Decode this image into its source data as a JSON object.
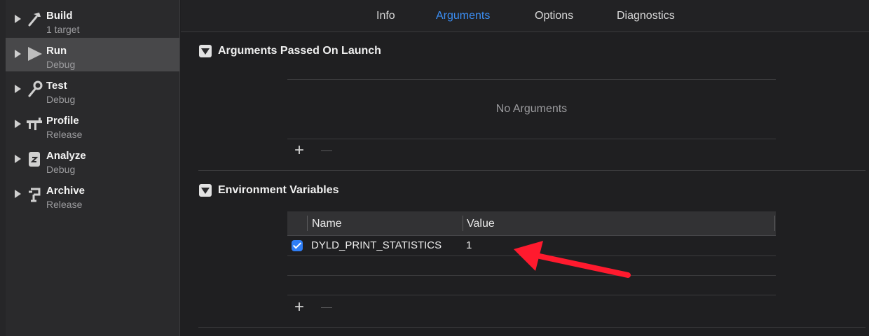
{
  "sidebar": {
    "items": [
      {
        "title": "Build",
        "subtitle": "1 target",
        "icon": "hammer-icon",
        "selected": false
      },
      {
        "title": "Run",
        "subtitle": "Debug",
        "icon": "play-icon",
        "selected": true
      },
      {
        "title": "Test",
        "subtitle": "Debug",
        "icon": "wrench-icon",
        "selected": false
      },
      {
        "title": "Profile",
        "subtitle": "Release",
        "icon": "instruments-icon",
        "selected": false
      },
      {
        "title": "Analyze",
        "subtitle": "Debug",
        "icon": "analyze-icon",
        "selected": false
      },
      {
        "title": "Archive",
        "subtitle": "Release",
        "icon": "archive-icon",
        "selected": false
      }
    ]
  },
  "tabs": [
    {
      "label": "Info",
      "active": false
    },
    {
      "label": "Arguments",
      "active": true
    },
    {
      "label": "Options",
      "active": false
    },
    {
      "label": "Diagnostics",
      "active": false
    }
  ],
  "arguments_section": {
    "title": "Arguments Passed On Launch",
    "empty_text": "No Arguments",
    "add_label": "+"
  },
  "env_section": {
    "title": "Environment Variables",
    "columns": [
      "Name",
      "Value"
    ],
    "rows": [
      {
        "enabled": true,
        "name": "DYLD_PRINT_STATISTICS",
        "value": "1"
      }
    ],
    "add_label": "+"
  },
  "colors": {
    "accent": "#3b8df2",
    "annotation_arrow": "#ff1a2e",
    "checkbox": "#2f7ef6"
  }
}
